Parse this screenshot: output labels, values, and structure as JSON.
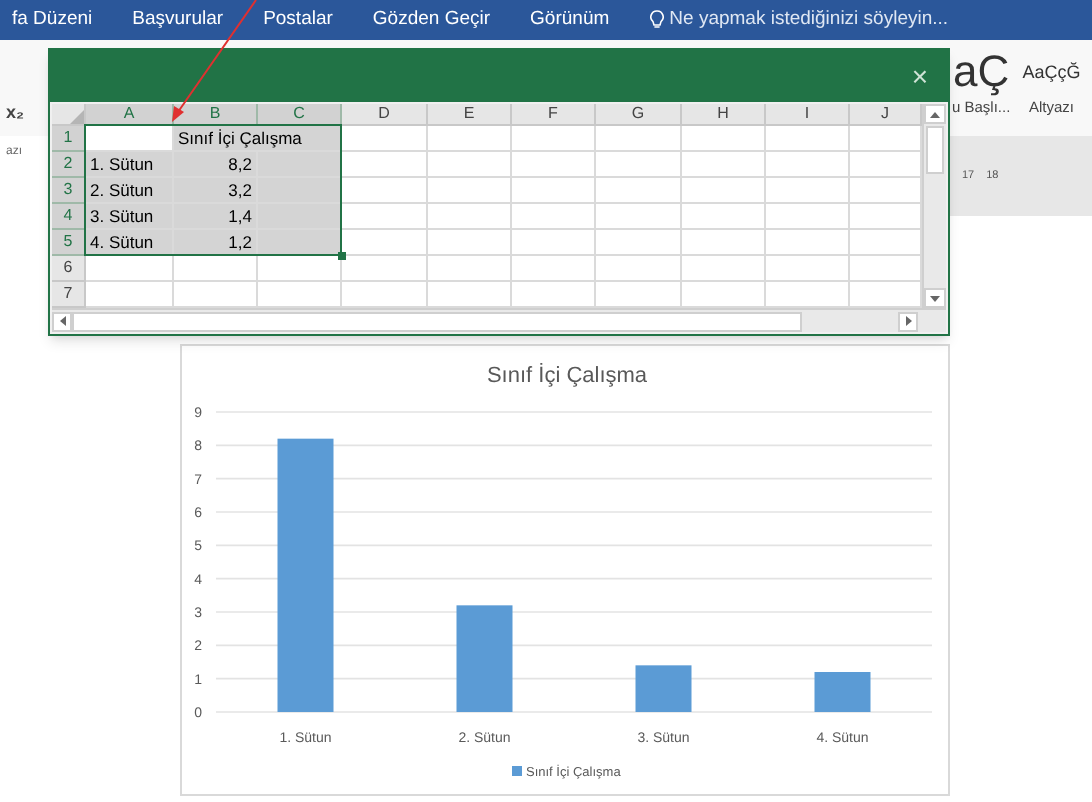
{
  "ribbon_tabs": [
    "fa Düzeni",
    "Başvurular",
    "Postalar",
    "Gözden Geçir",
    "Görünüm"
  ],
  "tell_me": {
    "placeholder": "Ne yapmak istediğinizi söyleyin..."
  },
  "left_labels": [
    "x₂",
    "azı"
  ],
  "styles": [
    {
      "sample": "aÇ",
      "name": "u Başlı..."
    },
    {
      "sample": "AaÇçĞ",
      "name": "Altyazı"
    }
  ],
  "ruler": [
    "17",
    "18"
  ],
  "spreadsheet": {
    "close": "×",
    "columns": [
      {
        "label": "A",
        "selected": true
      },
      {
        "label": "B",
        "selected": true
      },
      {
        "label": "C",
        "selected": true
      },
      {
        "label": "D",
        "selected": false
      },
      {
        "label": "E",
        "selected": false
      },
      {
        "label": "F",
        "selected": false
      },
      {
        "label": "G",
        "selected": false
      },
      {
        "label": "H",
        "selected": false
      },
      {
        "label": "I",
        "selected": false
      },
      {
        "label": "J",
        "selected": false
      }
    ],
    "rows": [
      {
        "header": "1",
        "selected": true,
        "value": "Sınıf İçi Çalışma"
      },
      {
        "header": "2",
        "selected": true,
        "label": "1. Sütun",
        "value": "8,2"
      },
      {
        "header": "3",
        "selected": true,
        "label": "2. Sütun",
        "value": "3,2"
      },
      {
        "header": "4",
        "selected": true,
        "label": "3. Sütun",
        "value": "1,4"
      },
      {
        "header": "5",
        "selected": true,
        "label": "4. Sütun",
        "value": "1,2"
      },
      {
        "header": "6",
        "selected": false
      },
      {
        "header": "7",
        "selected": false
      }
    ]
  },
  "chart": {
    "chart_data": {
      "type": "bar",
      "title": "Sınıf İçi Çalışma",
      "categories": [
        "1. Sütun",
        "2. Sütun",
        "3. Sütun",
        "4. Sütun"
      ],
      "series": [
        {
          "name": "Sınıf İçi Çalışma",
          "color": "#5b9bd5",
          "values": [
            8.2,
            3.2,
            1.4,
            1.2
          ]
        }
      ],
      "ylim": [
        0,
        9
      ],
      "grid": true,
      "yticks": [
        0,
        1,
        2,
        3,
        4,
        5,
        6,
        7,
        8,
        9
      ]
    }
  }
}
